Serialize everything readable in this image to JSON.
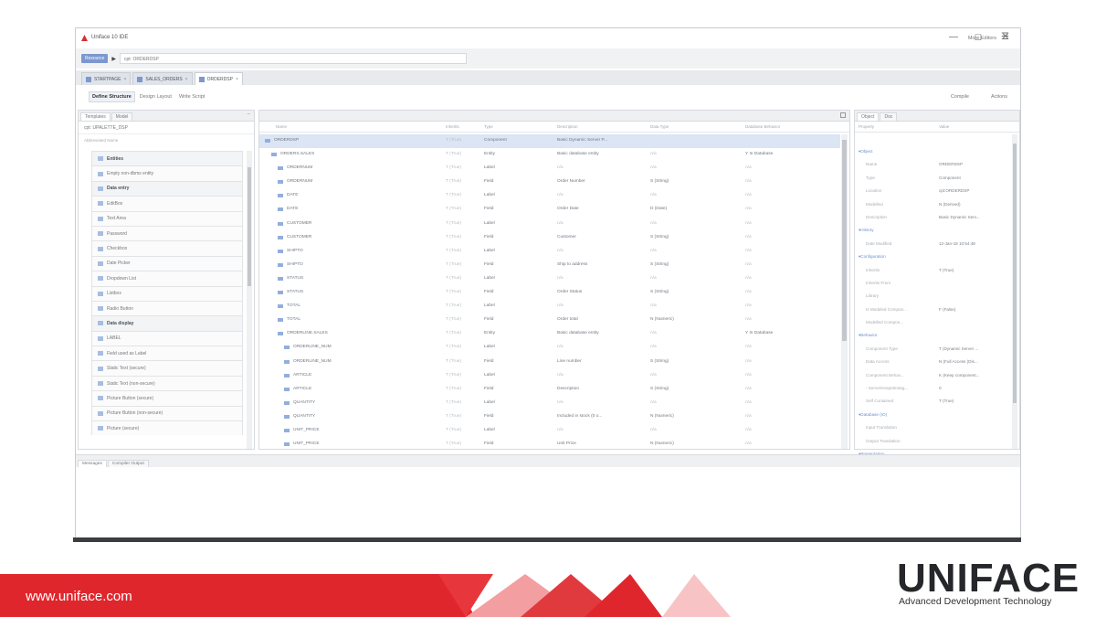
{
  "window": {
    "title": "Uniface 10 IDE",
    "minimize": "—",
    "maximize": "☐",
    "close": "✕"
  },
  "address": {
    "badge": "Resource",
    "arrow": "▶",
    "value": "cpt: ORDERDSP",
    "more_editors": "More Editors",
    "menu_glyph": "☰"
  },
  "tabs": [
    {
      "label": "STARTPAGE",
      "close": "×"
    },
    {
      "label": "SALES_ORDERS",
      "close": "×"
    },
    {
      "label": "ORDERDSP",
      "close": "×"
    }
  ],
  "toolbar": {
    "define": "Define Structure",
    "layout": "Design Layout",
    "script": "Write Script",
    "compile": "Compile",
    "actions": "Actions"
  },
  "palette": {
    "tabs": [
      "Templates",
      "Model"
    ],
    "min_glyph": "–",
    "header": "cpt: UPALETTE_DSP",
    "search": "Abbreviated Name",
    "items": [
      {
        "label": "Entities",
        "group": true
      },
      {
        "label": "Empty non-dbms entity",
        "group": false
      },
      {
        "label": "Data entry",
        "group": true
      },
      {
        "label": "EditBox",
        "group": false
      },
      {
        "label": "Text Area",
        "group": false
      },
      {
        "label": "Password",
        "group": false
      },
      {
        "label": "Checkbox",
        "group": false
      },
      {
        "label": "Date Picker",
        "group": false
      },
      {
        "label": "Dropdown List",
        "group": false
      },
      {
        "label": "Listbox",
        "group": false
      },
      {
        "label": "Radio Button",
        "group": false
      },
      {
        "label": "Data display",
        "group": true
      },
      {
        "label": "LABEL",
        "group": false
      },
      {
        "label": "Field used as Label",
        "group": false
      },
      {
        "label": "Static Text (secure)",
        "group": false
      },
      {
        "label": "Static Text (non-secure)",
        "group": false
      },
      {
        "label": "Picture Button (secure)",
        "group": false
      },
      {
        "label": "Picture Button (non-secure)",
        "group": false
      },
      {
        "label": "Picture (secure)",
        "group": false
      }
    ]
  },
  "grid": {
    "headers": [
      "Name",
      "Inherits",
      "Type",
      "Description",
      "Data Type",
      "Database Behavior"
    ],
    "rows": [
      {
        "indent": 0,
        "name": "ORDERDSP",
        "inherits": "T (True)",
        "type": "Component",
        "desc": "Basic Dynamic Server P...",
        "dtype": "",
        "db": "",
        "selected": true
      },
      {
        "indent": 1,
        "name": "ORDERS.SALES",
        "inherits": "T (True)",
        "type": "Entity",
        "desc": "Basic database entity",
        "dtype": "n/a",
        "db": "Y In Database"
      },
      {
        "indent": 2,
        "name": "ORDERNUM",
        "inherits": "T (True)",
        "type": "Label",
        "desc": "n/a",
        "dtype": "n/a",
        "db": "n/a"
      },
      {
        "indent": 2,
        "name": "ORDERNUM",
        "inherits": "T (True)",
        "type": "Field",
        "desc": "Order Number",
        "dtype": "S (String)",
        "db": "n/a"
      },
      {
        "indent": 2,
        "name": "DATE",
        "inherits": "T (True)",
        "type": "Label",
        "desc": "n/a",
        "dtype": "n/a",
        "db": "n/a"
      },
      {
        "indent": 2,
        "name": "DATE",
        "inherits": "T (True)",
        "type": "Field",
        "desc": "Order Date",
        "dtype": "D (Date)",
        "db": "n/a"
      },
      {
        "indent": 2,
        "name": "CUSTOMER",
        "inherits": "T (True)",
        "type": "Label",
        "desc": "n/a",
        "dtype": "n/a",
        "db": "n/a"
      },
      {
        "indent": 2,
        "name": "CUSTOMER",
        "inherits": "T (True)",
        "type": "Field",
        "desc": "Customer",
        "dtype": "S (String)",
        "db": "n/a"
      },
      {
        "indent": 2,
        "name": "SHIPTO",
        "inherits": "T (True)",
        "type": "Label",
        "desc": "n/a",
        "dtype": "n/a",
        "db": "n/a"
      },
      {
        "indent": 2,
        "name": "SHIPTO",
        "inherits": "T (True)",
        "type": "Field",
        "desc": "Ship to address",
        "dtype": "S (String)",
        "db": "n/a"
      },
      {
        "indent": 2,
        "name": "STATUS",
        "inherits": "T (True)",
        "type": "Label",
        "desc": "n/a",
        "dtype": "n/a",
        "db": "n/a"
      },
      {
        "indent": 2,
        "name": "STATUS",
        "inherits": "T (True)",
        "type": "Field",
        "desc": "Order Status",
        "dtype": "S (String)",
        "db": "n/a"
      },
      {
        "indent": 2,
        "name": "TOTAL",
        "inherits": "T (True)",
        "type": "Label",
        "desc": "n/a",
        "dtype": "n/a",
        "db": "n/a"
      },
      {
        "indent": 2,
        "name": "TOTAL",
        "inherits": "T (True)",
        "type": "Field",
        "desc": "Order total",
        "dtype": "N (Numeric)",
        "db": "n/a"
      },
      {
        "indent": 2,
        "name": "ORDERLINE.SALES",
        "inherits": "T (True)",
        "type": "Entity",
        "desc": "Basic database entity",
        "dtype": "n/a",
        "db": "Y In Database"
      },
      {
        "indent": 3,
        "name": "ORDERLINE_NUM",
        "inherits": "T (True)",
        "type": "Label",
        "desc": "n/a",
        "dtype": "n/a",
        "db": "n/a"
      },
      {
        "indent": 3,
        "name": "ORDERLINE_NUM",
        "inherits": "T (True)",
        "type": "Field",
        "desc": "Line number",
        "dtype": "S (String)",
        "db": "n/a"
      },
      {
        "indent": 3,
        "name": "ARTICLE",
        "inherits": "T (True)",
        "type": "Label",
        "desc": "n/a",
        "dtype": "n/a",
        "db": "n/a"
      },
      {
        "indent": 3,
        "name": "ARTICLE",
        "inherits": "T (True)",
        "type": "Field",
        "desc": "Description",
        "dtype": "S (String)",
        "db": "n/a"
      },
      {
        "indent": 3,
        "name": "QUANTITY",
        "inherits": "T (True)",
        "type": "Label",
        "desc": "n/a",
        "dtype": "n/a",
        "db": "n/a"
      },
      {
        "indent": 3,
        "name": "QUANTITY",
        "inherits": "T (True)",
        "type": "Field",
        "desc": "Included in stock (0 o...",
        "dtype": "N (Numeric)",
        "db": "n/a"
      },
      {
        "indent": 3,
        "name": "UNIT_PRICE",
        "inherits": "T (True)",
        "type": "Label",
        "desc": "n/a",
        "dtype": "n/a",
        "db": "n/a"
      },
      {
        "indent": 3,
        "name": "UNIT_PRICE",
        "inherits": "T (True)",
        "type": "Field",
        "desc": "Unit Price",
        "dtype": "N (Numeric)",
        "db": "n/a"
      }
    ]
  },
  "properties": {
    "tabs": [
      "Object",
      "Doc"
    ],
    "headers": [
      "Property",
      "Value"
    ],
    "rows": [
      {
        "section": "Object"
      },
      {
        "key": "Name",
        "value": "ORDERDSP"
      },
      {
        "key": "Type",
        "value": "Component"
      },
      {
        "key": "Location",
        "value": "cpt:ORDERDSP"
      },
      {
        "key": "Modelled",
        "value": "N (Derived)"
      },
      {
        "key": "Description",
        "value": "Basic Dynamic Serv..."
      },
      {
        "section": "History"
      },
      {
        "key": "Date Modified",
        "value": "12-Jan-18 10:54:48"
      },
      {
        "section": "Configuration"
      },
      {
        "key": "Inherits",
        "value": "T (True)"
      },
      {
        "key": "Inherits From",
        "value": ""
      },
      {
        "key": "Library",
        "value": ""
      },
      {
        "key": "Is Modeled Compon...",
        "value": "F (False)"
      },
      {
        "key": "Modelled Compon...",
        "value": ""
      },
      {
        "section": "Behavior"
      },
      {
        "key": "Component Type",
        "value": "T (Dynamic Server ..."
      },
      {
        "key": "Data Access",
        "value": "N (Full Access (Dis..."
      },
      {
        "key": "Component Behav...",
        "value": "K (Keep component..."
      },
      {
        "key": "- ServerKeepIdentag...",
        "value": "0"
      },
      {
        "key": "Self Contained",
        "value": "T (True)"
      },
      {
        "section": "Database (IO)"
      },
      {
        "key": "Input Translation",
        "value": ""
      },
      {
        "key": "Output Translation",
        "value": ""
      },
      {
        "section": "Presentation"
      }
    ]
  },
  "bottom_tabs": [
    "Messages",
    "Compiler Output"
  ],
  "footer": {
    "url": "www.uniface.com",
    "logo": "UNIFACE",
    "tagline": "Advanced Development Technology"
  }
}
